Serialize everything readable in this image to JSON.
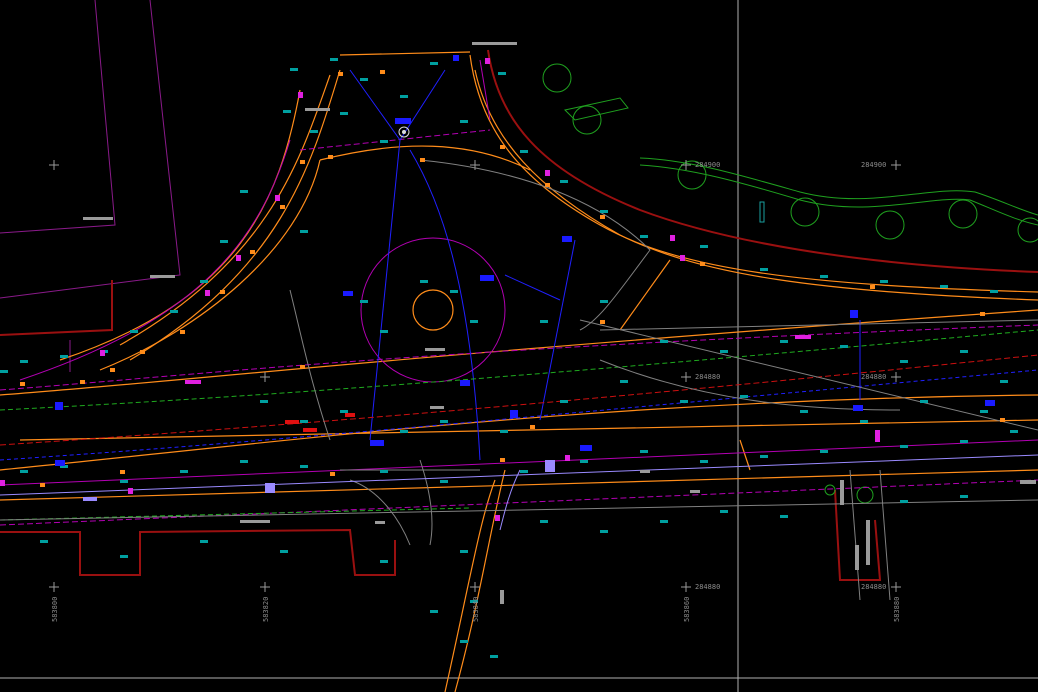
{
  "canvas": {
    "background": "#000000",
    "layer_colors": {
      "cable": "#ff8c1a",
      "boundary": "#b300b3",
      "water": "#1a1aff",
      "vegetation": "#22aa22",
      "curb": "#aa1111",
      "road": "#808080",
      "annotation": "#00a0a0"
    }
  },
  "grid_labels": {
    "northing_284900_a": "284900",
    "northing_284900_b": "284900",
    "northing_284880_a": "284880",
    "northing_284880_b": "284880",
    "northing_284880_c": "284880",
    "northing_284880_d": "284880",
    "easting_a": "583800",
    "easting_b": "583820",
    "easting_c": "583840",
    "easting_d": "583860",
    "easting_e": "583880"
  }
}
